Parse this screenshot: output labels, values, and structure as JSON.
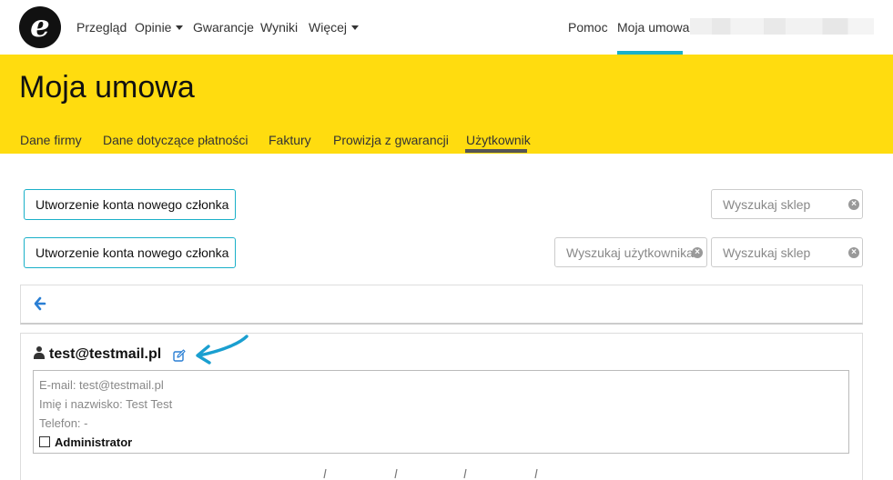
{
  "logo": {
    "letter": "e"
  },
  "nav": {
    "items": [
      {
        "label": "Przegląd",
        "dropdown": false
      },
      {
        "label": "Opinie",
        "dropdown": true
      },
      {
        "label": "Gwarancje",
        "dropdown": false
      },
      {
        "label": "Wyniki",
        "dropdown": false
      },
      {
        "label": "Więcej",
        "dropdown": true
      }
    ],
    "help": "Pomoc",
    "contract": "Moja umowa",
    "active": "Moja umowa"
  },
  "header": {
    "title": "Moja umowa",
    "tabs": [
      {
        "label": "Dane firmy"
      },
      {
        "label": "Dane dotyczące płatności"
      },
      {
        "label": "Faktury"
      },
      {
        "label": "Prowizja z gwarancji"
      },
      {
        "label": "Użytkownik"
      }
    ],
    "active_tab": "Użytkownik"
  },
  "actions": {
    "create_member_label_1": "Utworzenie konta nowego członka",
    "create_member_label_2": "Utworzenie konta nowego członka",
    "search_shop_placeholder": "Wyszukaj sklep",
    "search_user_placeholder": "Wyszukaj użytkownika"
  },
  "user": {
    "email_heading": "test@testmail.pl",
    "email_line": "E-mail: test@testmail.pl",
    "name_line": "Imię i nazwisko: Test Test",
    "phone_line": "Telefon: -",
    "admin_label": "Administrator",
    "admin_checked": false
  },
  "colors": {
    "brand_yellow": "#ffdc0f",
    "accent_teal": "#1ab0c8",
    "link_blue": "#2a7fd4",
    "annotation_arrow": "#1a9fd0"
  }
}
